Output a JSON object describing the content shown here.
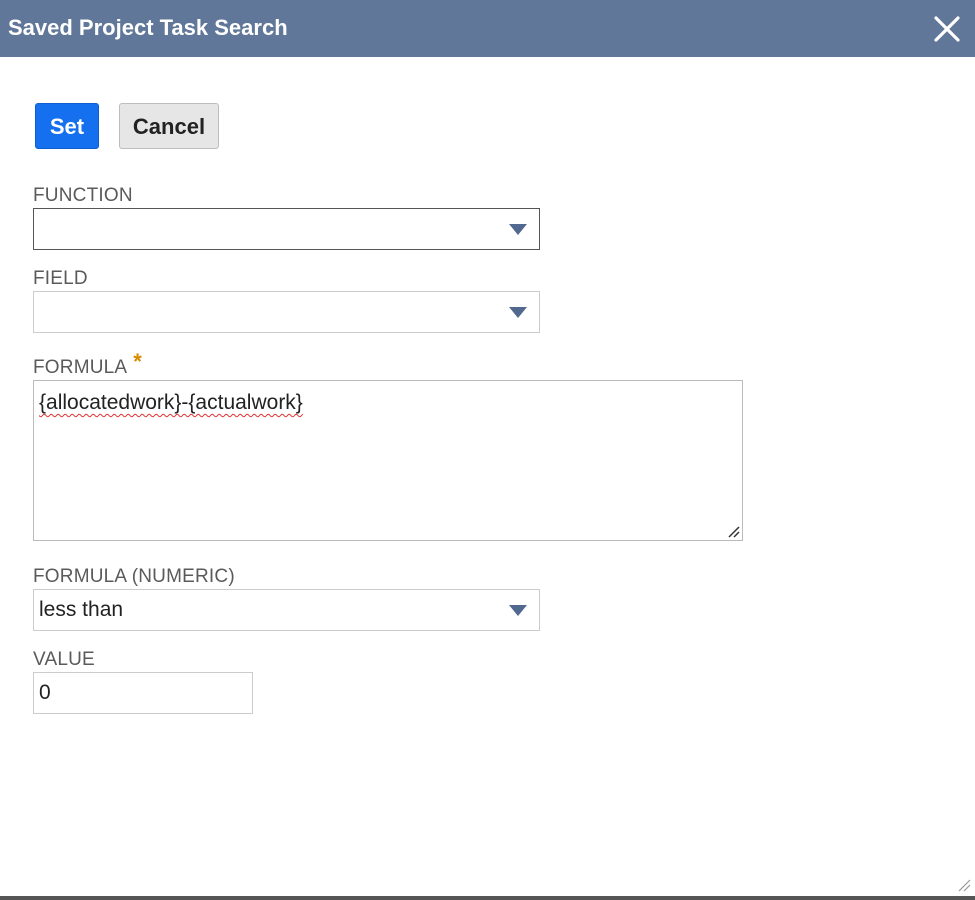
{
  "dialog": {
    "title": "Saved Project Task Search"
  },
  "toolbar": {
    "set_label": "Set",
    "cancel_label": "Cancel"
  },
  "fields": {
    "function": {
      "label": "FUNCTION",
      "value": ""
    },
    "field": {
      "label": "FIELD",
      "value": ""
    },
    "formula": {
      "label": "FORMULA",
      "required": "*",
      "value": "{allocatedwork}-{actualwork}"
    },
    "formula_numeric": {
      "label": "FORMULA (NUMERIC)",
      "value": "less than"
    },
    "value": {
      "label": "VALUE",
      "value": "0"
    }
  },
  "colors": {
    "titlebar": "#607799",
    "primary_button": "#1570ef",
    "required_star": "#d98a00",
    "dropdown_arrow": "#51698f"
  },
  "icons": {
    "close": "close-icon",
    "dropdown": "chevron-down-icon",
    "resize": "resize-grip-icon"
  }
}
